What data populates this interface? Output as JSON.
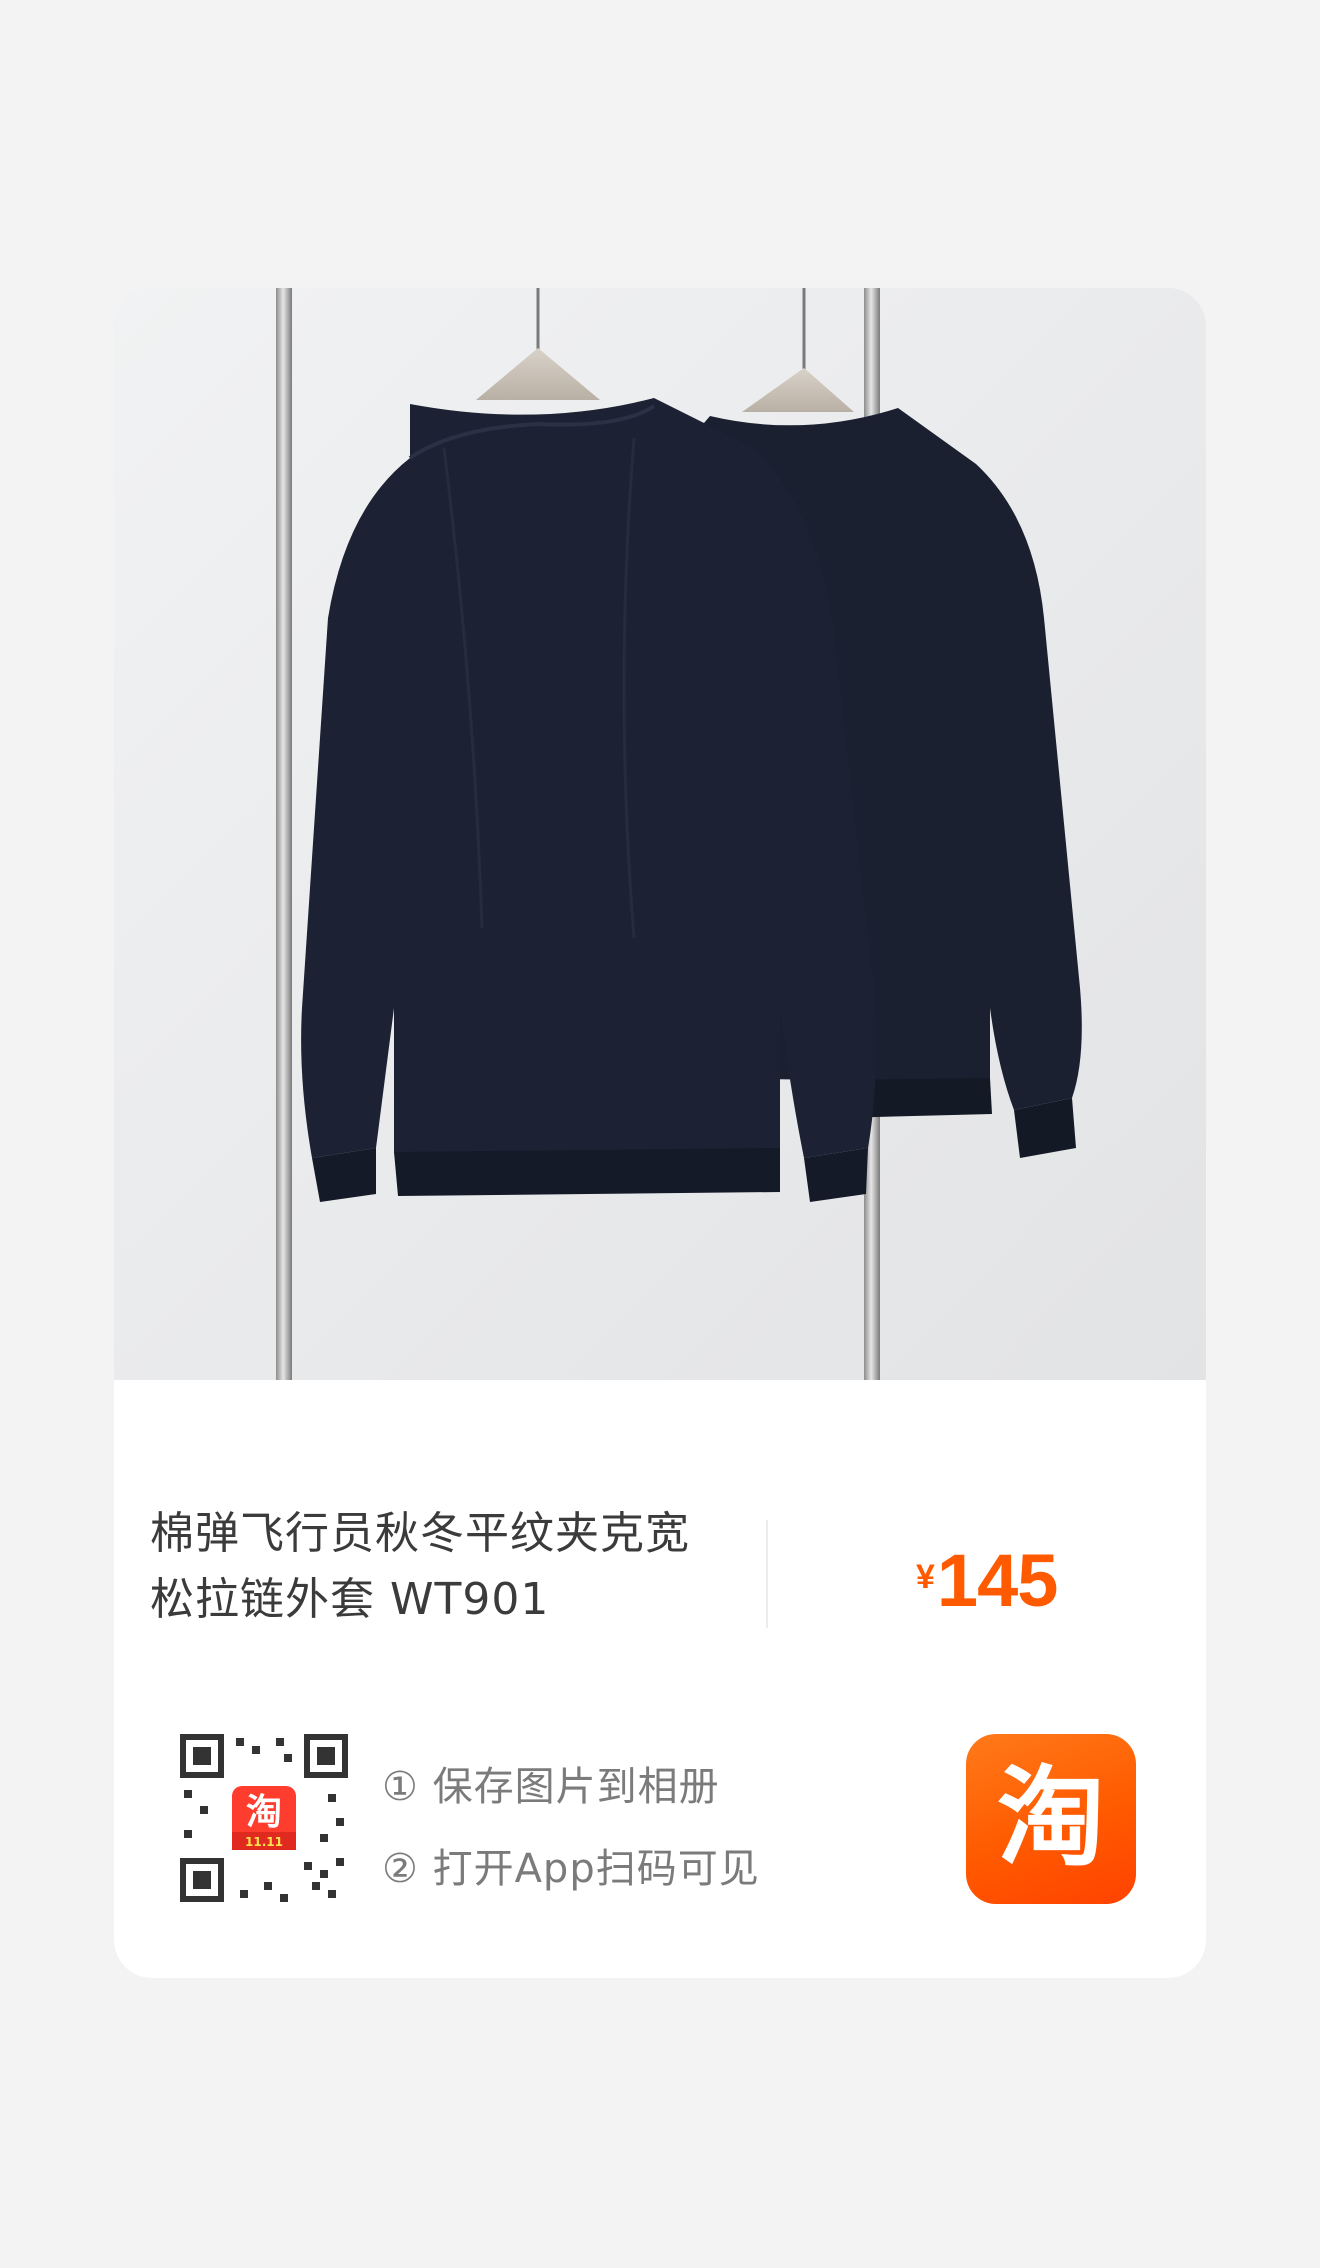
{
  "product": {
    "title_line1": "棉弹飞行员秋冬平纹夹克宽",
    "title_line2": "松拉链外套 WT901",
    "currency": "¥",
    "price": "145"
  },
  "qr": {
    "badge_text": "淘",
    "badge_sub": "11.11"
  },
  "instructions": [
    {
      "label": "① 保存图片到相册"
    },
    {
      "label": "② 打开App扫码可见"
    }
  ],
  "app_logo": {
    "glyph": "淘"
  },
  "colors": {
    "price": "#ff5a00",
    "logo_bg": "#ff5a00",
    "garment": "#1c2233",
    "photo_bg": "#e9eaec"
  }
}
